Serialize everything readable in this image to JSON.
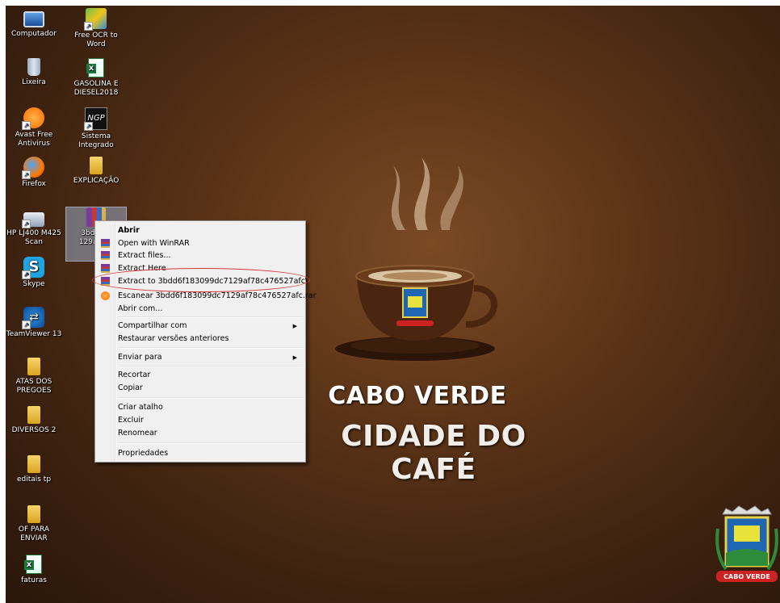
{
  "desktop": {
    "icons_left": [
      {
        "label": "Computador",
        "glyph": "computer-icon"
      },
      {
        "label": "Lixeira",
        "glyph": "recycle-bin-icon"
      },
      {
        "label": "Avast Free Antivirus",
        "glyph": "avast-icon"
      },
      {
        "label": "Firefox",
        "glyph": "firefox-icon"
      },
      {
        "label": "HP LJ400 M425 Scan",
        "glyph": "printer-icon"
      },
      {
        "label": "Skype",
        "glyph": "skype-icon"
      },
      {
        "label": "TeamViewer 13",
        "glyph": "teamviewer-icon"
      },
      {
        "label": "ATAS DOS PREGOES",
        "glyph": "folder-icon"
      },
      {
        "label": "DIVERSOS 2",
        "glyph": "folder-icon"
      },
      {
        "label": "editais tp",
        "glyph": "folder-icon"
      },
      {
        "label": "OF PARA ENVIAR",
        "glyph": "folder-icon"
      },
      {
        "label": "faturas",
        "glyph": "excel-icon"
      }
    ],
    "icons_right": [
      {
        "label": "Free OCR to Word",
        "glyph": "ocr-icon"
      },
      {
        "label": "GASOLINA E DIESEL2018",
        "glyph": "excel-icon"
      },
      {
        "label": "Sistema Integrado",
        "glyph": "ngp-icon"
      },
      {
        "label": "EXPLICAÇÃO",
        "glyph": "folder-icon"
      },
      {
        "label": "3bdd6f1\n129af78c",
        "glyph": "winrar-archive-icon"
      }
    ],
    "ngp_glyph_text": "NGP"
  },
  "wallpaper": {
    "title_line1": "CABO VERDE",
    "title_line2": "CIDADE DO CAFÉ",
    "crest_banner": "CABO VERDE"
  },
  "context_menu": {
    "items": [
      {
        "label": "Abrir",
        "bold": true
      },
      {
        "label": "Open with WinRAR",
        "icon": "winrar"
      },
      {
        "label": "Extract files...",
        "icon": "winrar"
      },
      {
        "label": "Extract Here",
        "icon": "winrar"
      },
      {
        "label": "Extract to 3bdd6f183099dc7129af78c476527afc\\",
        "icon": "winrar"
      },
      {
        "label": "Escanear 3bdd6f183099dc7129af78c476527afc.rar",
        "icon": "avast"
      },
      {
        "label": "Abrir com..."
      },
      {
        "label": "Compartilhar com",
        "submenu": true
      },
      {
        "label": "Restaurar versões anteriores"
      },
      {
        "label": "Enviar para",
        "submenu": true
      },
      {
        "label": "Recortar"
      },
      {
        "label": "Copiar"
      },
      {
        "label": "Criar atalho"
      },
      {
        "label": "Excluir"
      },
      {
        "label": "Renomear"
      },
      {
        "label": "Propriedades"
      }
    ],
    "submenu_arrow": "▶"
  }
}
